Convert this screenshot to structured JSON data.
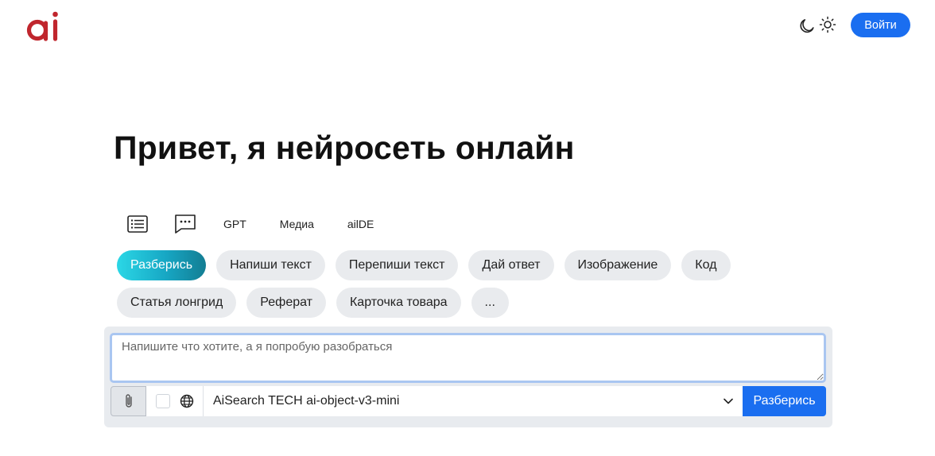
{
  "header": {
    "logo_icon": "ai-logo",
    "theme_icons": [
      "moon-icon",
      "sun-icon"
    ],
    "login_label": "Войти"
  },
  "hero": {
    "title": "Привет, я нейросеть онлайн"
  },
  "tabs": {
    "icons": [
      "list-icon",
      "chat-dots-icon"
    ],
    "items": [
      "GPT",
      "Медиа",
      "ailDE"
    ]
  },
  "chips": [
    {
      "label": "Разберись",
      "active": true
    },
    {
      "label": "Напиши текст",
      "active": false
    },
    {
      "label": "Перепиши текст",
      "active": false
    },
    {
      "label": "Дай ответ",
      "active": false
    },
    {
      "label": "Изображение",
      "active": false
    },
    {
      "label": "Код",
      "active": false
    },
    {
      "label": "Статья лонгрид",
      "active": false
    },
    {
      "label": "Реферат",
      "active": false
    },
    {
      "label": "Карточка товара",
      "active": false
    },
    {
      "label": "...",
      "active": false
    }
  ],
  "composer": {
    "placeholder": "Напишите что хотите, а я попробую разобраться",
    "value": "",
    "attach_icon": "paperclip-icon",
    "web_icon": "globe-icon",
    "web_search_checked": false,
    "model_selected": "AiSearch TECH ai-object-v3-mini",
    "submit_label": "Разберись"
  },
  "colors": {
    "brand_red": "#c0262d",
    "primary_blue": "#1a6ef0",
    "chip_bg": "#e9ebee",
    "active_gradient": [
      "#2bd7e6",
      "#137d93"
    ]
  }
}
